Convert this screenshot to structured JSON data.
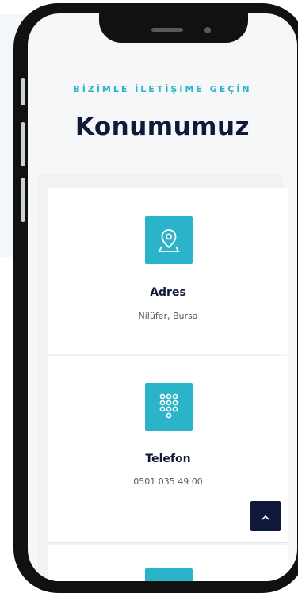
{
  "section": {
    "eyebrow": "BİZİMLE İLETİŞİME GEÇİN",
    "title": "Konumumuz"
  },
  "cards": [
    {
      "icon": "map-pin-icon",
      "title": "Adres",
      "value": "Nilüfer, Bursa"
    },
    {
      "icon": "keypad-icon",
      "title": "Telefon",
      "value": "0501 035 49 00"
    }
  ],
  "colors": {
    "accent": "#2bb3c9",
    "navy": "#0f1a3a"
  },
  "scroll_top": {
    "icon": "chevron-up-icon"
  }
}
